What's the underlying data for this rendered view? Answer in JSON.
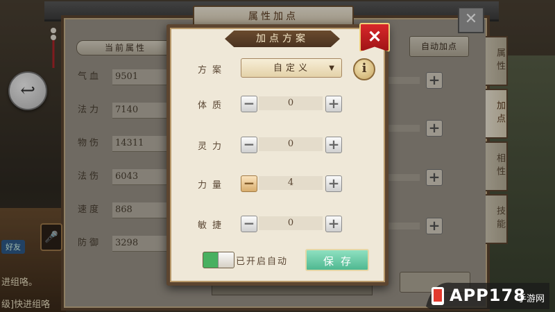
{
  "main_panel": {
    "title": "属性加点",
    "current_attr_label": "当前属性",
    "auto_button_label": "自动加点",
    "stats": [
      {
        "label": "气血",
        "value": "9501"
      },
      {
        "label": "法力",
        "value": "7140"
      },
      {
        "label": "物伤",
        "value": "14311"
      },
      {
        "label": "法伤",
        "value": "6043"
      },
      {
        "label": "速度",
        "value": "868"
      },
      {
        "label": "防御",
        "value": "3298"
      }
    ],
    "side_tabs": [
      "属性",
      "加点",
      "相性",
      "技能"
    ],
    "active_tab": "加点"
  },
  "chat": {
    "line1": "进组咯。",
    "line2": "级]快进组咯",
    "tag": "好友"
  },
  "dialog": {
    "title": "加点方案",
    "scheme_label": "方案",
    "scheme_value": "自定义",
    "info_icon": "i",
    "rows": [
      {
        "label": "体质",
        "value": "0"
      },
      {
        "label": "灵力",
        "value": "0"
      },
      {
        "label": "力量",
        "value": "4"
      },
      {
        "label": "敏捷",
        "value": "0"
      }
    ],
    "toggle_label": "已开启自动",
    "toggle_on": true,
    "save_label": "保存"
  },
  "icons": {
    "back": "back-arrow-icon",
    "close": "close-icon",
    "info": "info-icon",
    "minus": "minus-icon",
    "plus": "plus-icon",
    "mic": "microphone-icon"
  },
  "watermark": {
    "brand": "APP178",
    "sub": "手游网"
  },
  "colors": {
    "close_red": "#c41f22",
    "save_green": "#4fb891",
    "toggle_green": "#48b060"
  }
}
